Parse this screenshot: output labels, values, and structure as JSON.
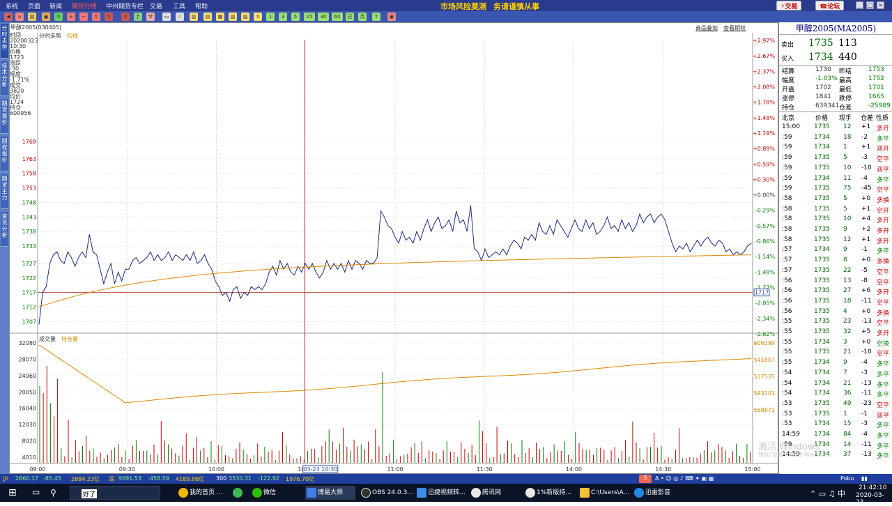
{
  "menu": {
    "items": [
      "系统",
      "页面",
      "新闻",
      "期货行情",
      "中州期货专栏",
      "交易",
      "工具",
      "帮助"
    ],
    "slogan_left": "市场风险莫测",
    "slogan_right": "务请谨慎从事",
    "trade_button": "交易",
    "forum_button": "论坛"
  },
  "toolbar": {
    "period_buttons": [
      "1",
      "3",
      "5",
      "15",
      "30",
      "60",
      "日",
      "月"
    ]
  },
  "sidebar": {
    "tabs": [
      "分时走势",
      "技术分析",
      "期货报价",
      "期权报价",
      "期货主力",
      "资讯分析"
    ]
  },
  "chart_header": {
    "instrument": "甲醇2005(030405)",
    "price_label": "分时走势",
    "avg_label": "均线",
    "link1": "商品叠加",
    "link2": "查看期权"
  },
  "info_panel": {
    "time_label": "时间",
    "time_value1": "20200323",
    "time_value2": "10:30",
    "price_label": "价格",
    "price_value": "1723",
    "change_label": "涨跌",
    "change_value": "-30",
    "amp_label": "幅度",
    "amp_value": "-1.71%",
    "vol_label": "成交",
    "vol_value": "3820",
    "avg_label": "均价",
    "avg_value": "1724",
    "oi_label": "持仓",
    "oi_value": "600956"
  },
  "chart_data": {
    "type": "line",
    "price_axis": {
      "left_ticks": [
        "1769",
        "1763",
        "1758",
        "1753",
        "1748",
        "1743",
        "1738",
        "1733",
        "1727",
        "1722",
        "1717",
        "1712",
        "1707"
      ],
      "right_ticks": [
        "+2.97%",
        "+2.67%",
        "+2.37%",
        "+2.08%",
        "+1.78%",
        "+1.48%",
        "+1.19%",
        "+0.89%",
        "+0.59%",
        "+0.30%",
        "+0.00%",
        "-0.29%",
        "-0.57%",
        "-0.86%",
        "-1.14%",
        "-1.48%",
        "-1.77%",
        "-2.05%",
        "-2.34%",
        "-2.62%"
      ],
      "ylim": [
        1703,
        1804
      ],
      "prev_settle": 1753,
      "ref_price": 1717,
      "ref_label": "1717"
    },
    "x_ticks": [
      "09:00",
      "09:30",
      "10:00",
      "10:30",
      "11:00",
      "11:30",
      "14:00",
      "14:30",
      "15:00"
    ],
    "cursor_label": "03-23 10:30",
    "price_series": [
      1706,
      1717,
      1719,
      1727,
      1730,
      1731,
      1728,
      1727,
      1731,
      1729,
      1726,
      1729,
      1731,
      1729,
      1737,
      1731,
      1730,
      1725,
      1720,
      1724,
      1727,
      1720,
      1724,
      1721,
      1725,
      1725,
      1728,
      1729,
      1727,
      1728,
      1729,
      1731,
      1728,
      1730,
      1728,
      1729,
      1731,
      1728,
      1730,
      1729,
      1728,
      1730,
      1728,
      1731,
      1727,
      1728,
      1730,
      1727,
      1725,
      1721,
      1719,
      1716,
      1717,
      1714,
      1718,
      1719,
      1715,
      1717,
      1716,
      1719,
      1718,
      1719,
      1718,
      1720,
      1724,
      1726,
      1723,
      1728,
      1725,
      1727,
      1724,
      1723,
      1726,
      1724,
      1727,
      1725,
      1727,
      1724,
      1722,
      1724,
      1728,
      1725,
      1727,
      1725,
      1727,
      1724,
      1728,
      1725,
      1728,
      1727,
      1725,
      1728,
      1727,
      1727,
      1729,
      1745,
      1743,
      1740,
      1739,
      1736,
      1734,
      1738,
      1735,
      1736,
      1734,
      1738,
      1735,
      1739,
      1742,
      1738,
      1741,
      1743,
      1739,
      1740,
      1742,
      1738,
      1745,
      1741,
      1742,
      1738,
      1747,
      1732,
      1731,
      1728,
      1732,
      1729,
      1730,
      1731,
      1730,
      1732,
      1730,
      1733,
      1735,
      1734,
      1732,
      1736,
      1735,
      1737,
      1735,
      1741,
      1738,
      1737,
      1740,
      1737,
      1742,
      1740,
      1738,
      1736,
      1739,
      1742,
      1739,
      1738,
      1742,
      1739,
      1741,
      1737,
      1738,
      1740,
      1743,
      1739,
      1740,
      1738,
      1742,
      1739,
      1741,
      1738,
      1740,
      1744,
      1741,
      1743,
      1744,
      1741,
      1743,
      1744,
      1742,
      1738,
      1734,
      1731,
      1733,
      1732,
      1734,
      1731,
      1733,
      1735,
      1733,
      1735,
      1736,
      1734,
      1733,
      1735,
      1734,
      1731,
      1732,
      1730,
      1731,
      1730,
      1731,
      1733,
      1734
    ],
    "avg_series_start": 1712,
    "avg_series_end": 1730,
    "volume_axis": {
      "left_ticks": [
        "32080",
        "28070",
        "24060",
        "20050",
        "16040",
        "12030",
        "8020",
        "4010"
      ],
      "right_ticks": [
        "606199",
        "541807",
        "517535",
        "593203",
        "568871"
      ],
      "vol_label": "成交量",
      "oi_label": "持仓量"
    }
  },
  "right_panel": {
    "title": "甲醇2005(MA2005)",
    "ask_label": "卖出",
    "ask_price": "1735",
    "ask_vol": "113",
    "bid_label": "买入",
    "bid_price": "1734",
    "bid_vol": "440",
    "stats": [
      [
        "结算",
        "1730",
        "昨结",
        "1753"
      ],
      [
        "幅度",
        "-1.03%",
        "最高",
        "1752"
      ],
      [
        "开盘",
        "1702",
        "最低",
        "1701"
      ],
      [
        "涨停",
        "1841",
        "跌停",
        "1665"
      ],
      [
        "持仓",
        "639341",
        "仓差",
        "-25989"
      ]
    ],
    "tick_header": [
      "北京",
      "价格",
      "现手",
      "仓差",
      "性质"
    ],
    "ticks": [
      [
        "15:00",
        "1735",
        "12",
        "+1",
        "多开"
      ],
      [
        ":59",
        "1734",
        "18",
        "-2",
        "多平"
      ],
      [
        ":59",
        "1734",
        "1",
        "+1",
        "双开"
      ],
      [
        ":59",
        "1735",
        "5",
        "-3",
        "空平"
      ],
      [
        ":59",
        "1735",
        "10",
        "-10",
        "双平"
      ],
      [
        ":59",
        "1734",
        "11",
        "-4",
        "多平"
      ],
      [
        ":59",
        "1735",
        "75",
        "-45",
        "空平"
      ],
      [
        ":58",
        "1735",
        "5",
        "+0",
        "多换"
      ],
      [
        ":58",
        "1735",
        "5",
        "+1",
        "空开"
      ],
      [
        ":58",
        "1735",
        "10",
        "+4",
        "多开"
      ],
      [
        ":58",
        "1735",
        "9",
        "+2",
        "多开"
      ],
      [
        ":58",
        "1735",
        "12",
        "+1",
        "多开"
      ],
      [
        ":57",
        "1734",
        "9",
        "-1",
        "多平"
      ],
      [
        ":57",
        "1735",
        "8",
        "+0",
        "多换"
      ],
      [
        ":57",
        "1735",
        "22",
        "-5",
        "空平"
      ],
      [
        ":56",
        "1735",
        "13",
        "-8",
        "空平"
      ],
      [
        ":56",
        "1735",
        "27",
        "+6",
        "多开"
      ],
      [
        ":56",
        "1735",
        "18",
        "-11",
        "空平"
      ],
      [
        ":56",
        "1735",
        "4",
        "+0",
        "多换"
      ],
      [
        ":55",
        "1735",
        "23",
        "-13",
        "空平"
      ],
      [
        ":55",
        "1735",
        "32",
        "+5",
        "多开"
      ],
      [
        ":55",
        "1734",
        "3",
        "+0",
        "空换"
      ],
      [
        ":55",
        "1735",
        "21",
        "-10",
        "空平"
      ],
      [
        ":55",
        "1734",
        "9",
        "-4",
        "多平"
      ],
      [
        ":54",
        "1734",
        "7",
        "-3",
        "多平"
      ],
      [
        ":54",
        "1734",
        "21",
        "-13",
        "多平"
      ],
      [
        ":54",
        "1734",
        "36",
        "-11",
        "多平"
      ],
      [
        ":53",
        "1735",
        "49",
        "-23",
        "空平"
      ],
      [
        ":53",
        "1735",
        "1",
        "-1",
        "双平"
      ],
      [
        ":53",
        "1734",
        "15",
        "-3",
        "多平"
      ],
      [
        "14:59",
        "1734",
        "84",
        "-4",
        "多平"
      ],
      [
        ":59",
        "1734",
        "14",
        "-11",
        "多平"
      ],
      [
        "14:59",
        "1734",
        "37",
        "-13",
        "多平"
      ]
    ]
  },
  "status_bar": {
    "sh_index": "2660.17",
    "sh_change": "-85.45",
    "sh_amount": "2684.23亿",
    "sz_label": "深",
    "sz_index": "9691.53",
    "sz_change": "-458.59",
    "sz_amount": "4189.86亿",
    "hs300_label": "300",
    "hs300_index": "3530.31",
    "hs300_change": "-122.92",
    "hs300_amount": "1976.70亿",
    "brand": "Pobo"
  },
  "watermark": {
    "line1": "激活 Windows",
    "line2": "转到\"设置\"以激活 Windows。"
  },
  "taskbar": {
    "search_text": "好了",
    "tasks": [
      "我的首页 ...",
      "微信",
      "博易大师",
      "OBS 24.0.3...",
      "迅捷视频转...",
      "腾讯网",
      "1%新版持...",
      "C:\\Users\\A...",
      "迅雷影音"
    ],
    "time": "21:42:10",
    "date": "2020-03-23"
  },
  "colors": {
    "price_line": "#1a2a7a",
    "avg_line": "#d98a00",
    "down": "#008000",
    "up": "#c00000",
    "axis_red": "#d00000",
    "axis_green": "#008000",
    "title_blue": "#000080"
  }
}
